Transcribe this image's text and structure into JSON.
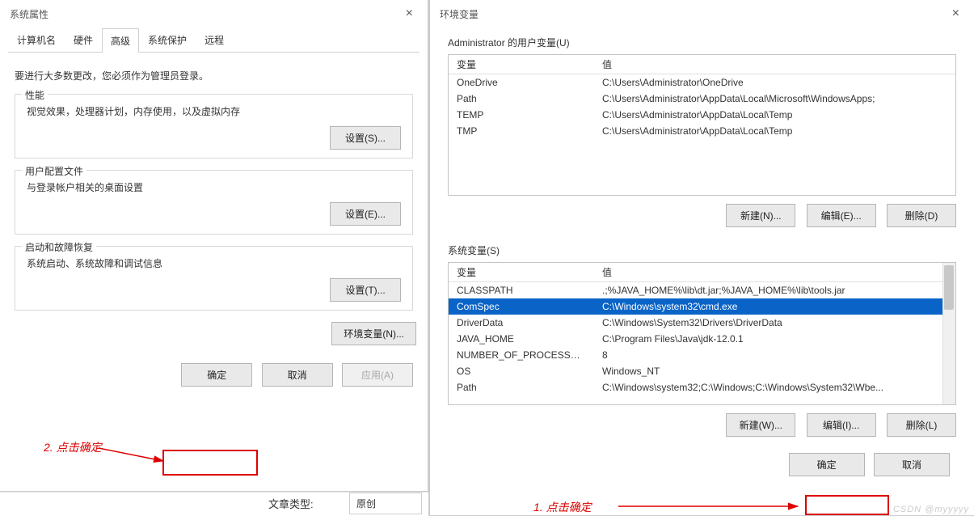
{
  "left": {
    "title": "系统属性",
    "tabs": [
      "计算机名",
      "硬件",
      "高级",
      "系统保护",
      "远程"
    ],
    "activeTab": 2,
    "note": "要进行大多数更改，您必须作为管理员登录。",
    "groups": [
      {
        "title": "性能",
        "desc": "视觉效果，处理器计划，内存使用，以及虚拟内存",
        "btn": "设置(S)..."
      },
      {
        "title": "用户配置文件",
        "desc": "与登录帐户相关的桌面设置",
        "btn": "设置(E)..."
      },
      {
        "title": "启动和故障恢复",
        "desc": "系统启动、系统故障和调试信息",
        "btn": "设置(T)..."
      }
    ],
    "envBtn": "环境变量(N)...",
    "ok": "确定",
    "cancel": "取消",
    "apply": "应用(A)"
  },
  "right": {
    "title": "环境变量",
    "userLabel": "Administrator 的用户变量(U)",
    "headers": {
      "var": "变量",
      "val": "值"
    },
    "userVars": [
      {
        "name": "OneDrive",
        "value": "C:\\Users\\Administrator\\OneDrive"
      },
      {
        "name": "Path",
        "value": "C:\\Users\\Administrator\\AppData\\Local\\Microsoft\\WindowsApps;"
      },
      {
        "name": "TEMP",
        "value": "C:\\Users\\Administrator\\AppData\\Local\\Temp"
      },
      {
        "name": "TMP",
        "value": "C:\\Users\\Administrator\\AppData\\Local\\Temp"
      }
    ],
    "sysLabel": "系统变量(S)",
    "sysVars": [
      {
        "name": "CLASSPATH",
        "value": ".;%JAVA_HOME%\\lib\\dt.jar;%JAVA_HOME%\\lib\\tools.jar"
      },
      {
        "name": "ComSpec",
        "value": "C:\\Windows\\system32\\cmd.exe",
        "selected": true
      },
      {
        "name": "DriverData",
        "value": "C:\\Windows\\System32\\Drivers\\DriverData"
      },
      {
        "name": "JAVA_HOME",
        "value": "C:\\Program Files\\Java\\jdk-12.0.1"
      },
      {
        "name": "NUMBER_OF_PROCESSORS",
        "value": "8"
      },
      {
        "name": "OS",
        "value": "Windows_NT"
      },
      {
        "name": "Path",
        "value": "C:\\Windows\\system32;C:\\Windows;C:\\Windows\\System32\\Wbe..."
      }
    ],
    "new": "新建(N)...",
    "edit": "编辑(E)...",
    "del": "删除(D)",
    "newW": "新建(W)...",
    "editI": "编辑(I)...",
    "delL": "删除(L)",
    "ok": "确定",
    "cancel": "取消"
  },
  "annot": {
    "left": "2.  点击确定",
    "right": "1.  点击确定"
  },
  "footer": {
    "label": "文章类型:",
    "value": "原创"
  },
  "watermark": "CSDN @myyyyy"
}
